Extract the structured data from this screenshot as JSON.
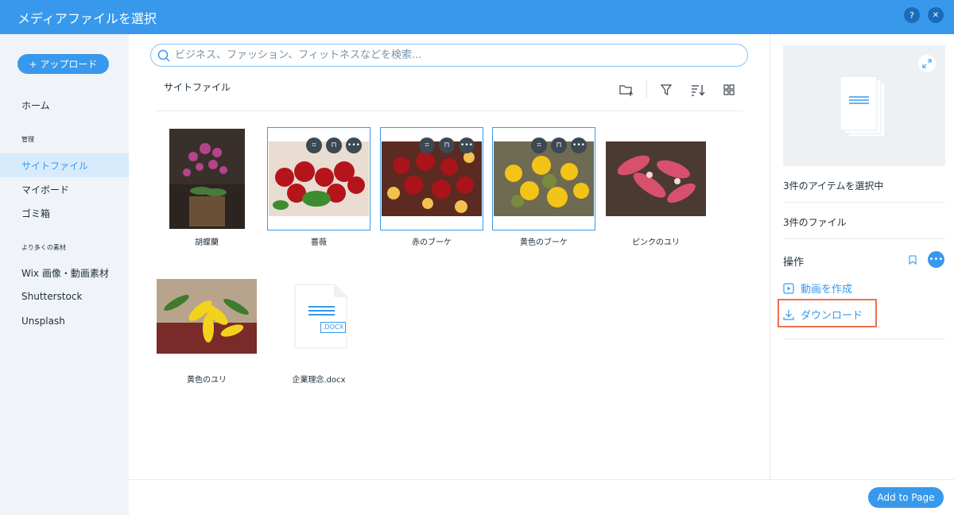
{
  "header": {
    "title": "メディアファイルを選択",
    "help_label": "?",
    "close_label": "✕"
  },
  "sidebar": {
    "upload_label": "+ アップロード",
    "home": "ホーム",
    "section_manage": "管理",
    "items_manage": [
      "サイトファイル",
      "マイボード",
      "ゴミ箱"
    ],
    "section_more": "より多くの素材",
    "items_more": [
      "Wix 画像・動画素材",
      "Shutterstock",
      "Unsplash"
    ]
  },
  "main": {
    "search_placeholder": "ビジネス、ファッション、フィットネスなどを検索...",
    "folder_title": "サイトファイル",
    "files": [
      {
        "name": "胡蝶蘭",
        "selected": false
      },
      {
        "name": "薔薇",
        "selected": true
      },
      {
        "name": "赤のブーケ",
        "selected": true
      },
      {
        "name": "黄色のブーケ",
        "selected": true
      },
      {
        "name": "ピンクのユリ",
        "selected": false
      },
      {
        "name": "黄色のユリ",
        "selected": false
      },
      {
        "name": "企業理念.docx",
        "selected": false,
        "badge": ".DOCX"
      }
    ]
  },
  "right_panel": {
    "selected_count": "3件のアイテムを選択中",
    "file_count": "3件のファイル",
    "actions_heading": "操作",
    "actions": [
      "動画を作成",
      "ダウンロード"
    ]
  },
  "footer": {
    "add_button": "Add to Page"
  },
  "colors": {
    "accent": "#3899ec",
    "highlight": "#f06e4f",
    "sidebar_bg": "#f0f4f8"
  }
}
